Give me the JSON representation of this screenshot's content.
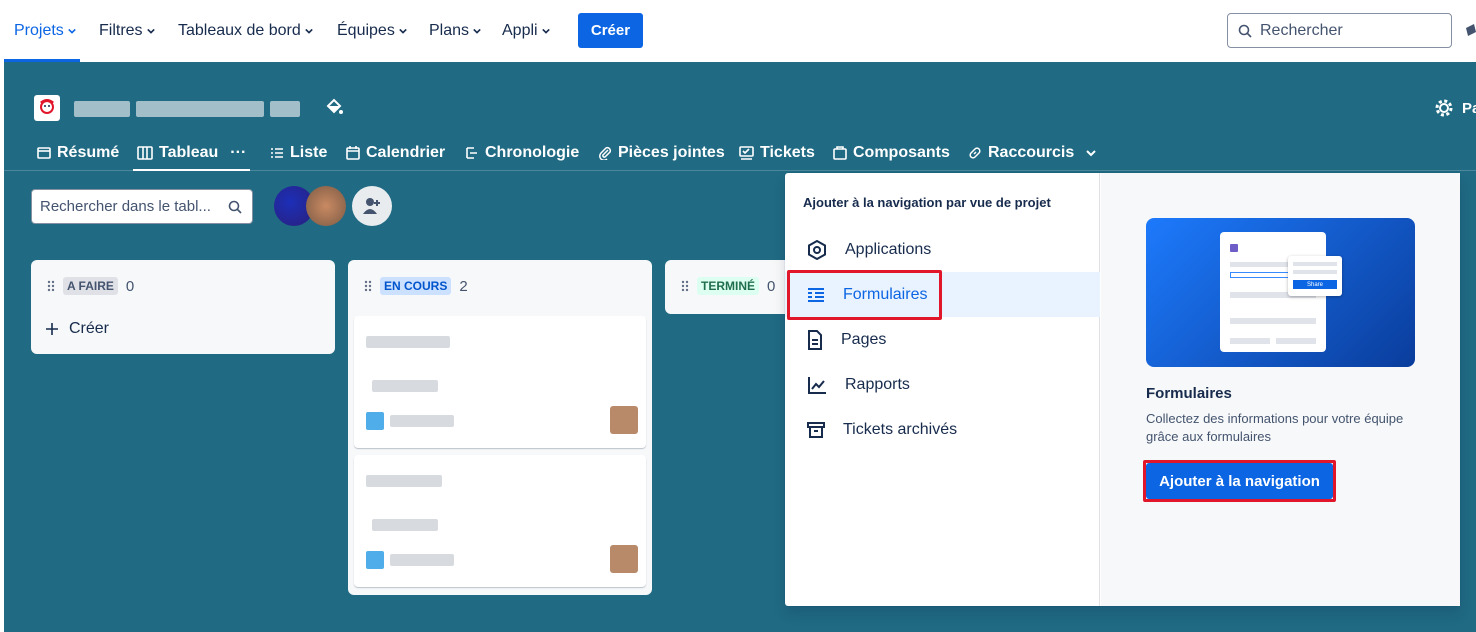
{
  "topnav": {
    "items": [
      {
        "label": "Projets",
        "active": true
      },
      {
        "label": "Filtres"
      },
      {
        "label": "Tableaux de bord"
      },
      {
        "label": "Équipes"
      },
      {
        "label": "Plans"
      },
      {
        "label": "Appli"
      }
    ],
    "create_label": "Créer",
    "search_placeholder": "Rechercher"
  },
  "project": {
    "title": "Projet (masqué)",
    "settings_label": "Pa",
    "tabs": [
      {
        "label": "Résumé",
        "icon": "summary-icon"
      },
      {
        "label": "Tableau",
        "icon": "board-icon",
        "active": true
      },
      {
        "label": "Liste",
        "icon": "list-icon"
      },
      {
        "label": "Calendrier",
        "icon": "calendar-icon"
      },
      {
        "label": "Chronologie",
        "icon": "timeline-icon"
      },
      {
        "label": "Pièces jointes",
        "icon": "attachment-icon"
      },
      {
        "label": "Tickets",
        "icon": "tickets-icon"
      },
      {
        "label": "Composants",
        "icon": "components-icon"
      },
      {
        "label": "Raccourcis",
        "icon": "link-icon"
      }
    ],
    "tab_more": "···",
    "board_search_placeholder": "Rechercher dans le tabl..."
  },
  "board": {
    "columns": [
      {
        "status": "A FAIRE",
        "count": "0",
        "create_label": "Créer"
      },
      {
        "status": "EN COURS",
        "count": "2"
      },
      {
        "status": "TERMINÉ",
        "count": "0"
      }
    ]
  },
  "popup": {
    "heading": "Ajouter à la navigation par vue de projet",
    "items": [
      {
        "label": "Applications",
        "icon": "applications-icon"
      },
      {
        "label": "Formulaires",
        "icon": "forms-icon",
        "selected": true
      },
      {
        "label": "Pages",
        "icon": "pages-icon"
      },
      {
        "label": "Rapports",
        "icon": "reports-icon"
      },
      {
        "label": "Tickets archivés",
        "icon": "archive-icon"
      }
    ],
    "promo": {
      "title": "Formulaires",
      "description": "Collectez des informations pour votre équipe grâce aux formulaires",
      "button_label": "Ajouter à la navigation",
      "share_label": "Share"
    }
  },
  "colors": {
    "primary": "#0c66e4",
    "project_bg": "#206a83",
    "highlight": "#e2162a"
  }
}
